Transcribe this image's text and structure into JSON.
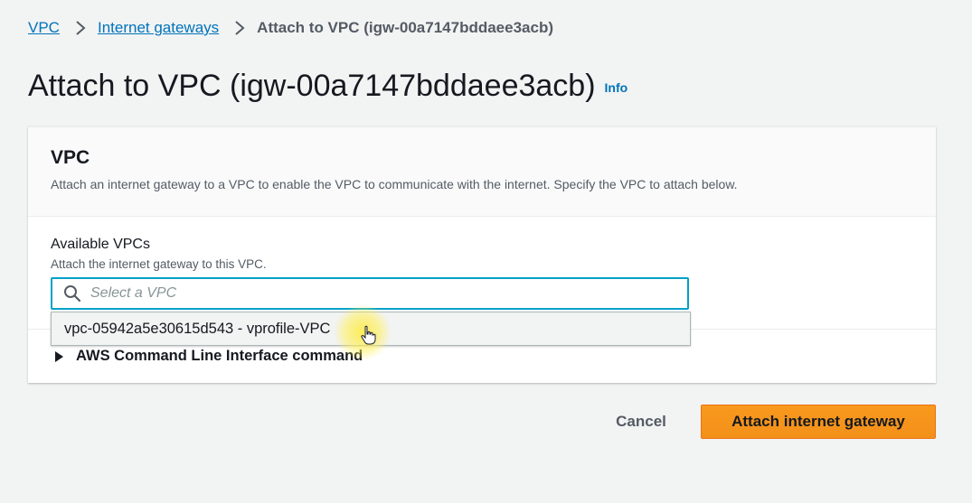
{
  "breadcrumb": {
    "items": [
      {
        "label": "VPC"
      },
      {
        "label": "Internet gateways"
      }
    ],
    "current": "Attach to VPC (igw-00a7147bddaee3acb)"
  },
  "page": {
    "title": "Attach to VPC (igw-00a7147bddaee3acb)",
    "info_label": "Info"
  },
  "panel": {
    "title": "VPC",
    "description": "Attach an internet gateway to a VPC to enable the VPC to communicate with the internet. Specify the VPC to attach below.",
    "field": {
      "label": "Available VPCs",
      "description": "Attach the internet gateway to this VPC.",
      "placeholder": "Select a VPC",
      "value": "",
      "icon": "search-icon"
    },
    "dropdown": {
      "options": [
        {
          "label": "vpc-05942a5e30615d543 - vprofile-VPC"
        }
      ]
    },
    "cli_toggle_label": "AWS Command Line Interface command"
  },
  "actions": {
    "cancel_label": "Cancel",
    "primary_label": "Attach internet gateway"
  },
  "colors": {
    "link": "#0073bb",
    "primary": "#ec7211",
    "focus_border": "#00a1c9",
    "background": "#f2f3f3"
  }
}
